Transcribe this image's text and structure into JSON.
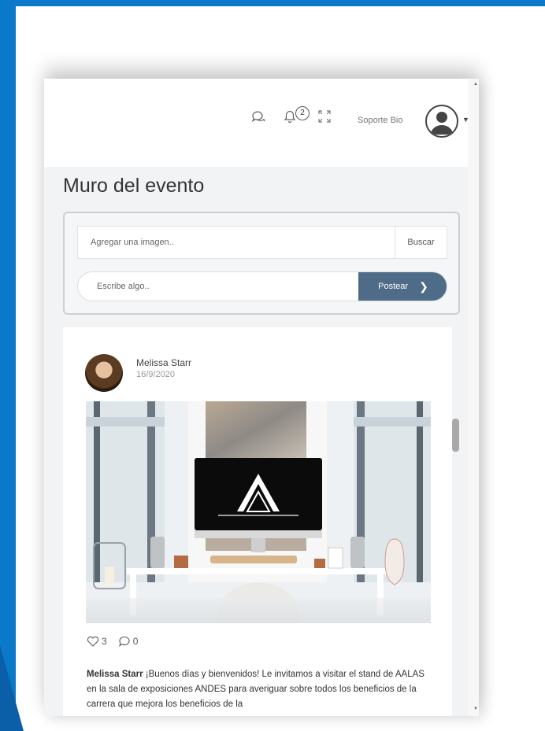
{
  "header": {
    "support_label": "Soporte Bio",
    "notification_count": "2",
    "icons": [
      "chat-icon",
      "bell-icon",
      "expand-icon",
      "user-avatar-icon"
    ]
  },
  "page": {
    "title": "Muro del evento"
  },
  "composer": {
    "image_placeholder": "Agregar una imagen..",
    "browse_label": "Buscar",
    "text_placeholder": "Escribe algo..",
    "post_label": "Postear"
  },
  "post": {
    "author": "Melissa Starr",
    "date": "16/9/2020",
    "likes": "3",
    "comments": "0",
    "body_author": "Melissa Starr",
    "body_text": " ¡Buenos días y bienvenidos! Le invitamos a visitar el stand de AALAS en la sala de exposiciones ANDES para averiguar sobre todos los beneficios de la carrera que mejora los beneficios de la"
  },
  "colors": {
    "frame_blue": "#0a79c9",
    "post_button": "#4e6b87"
  }
}
